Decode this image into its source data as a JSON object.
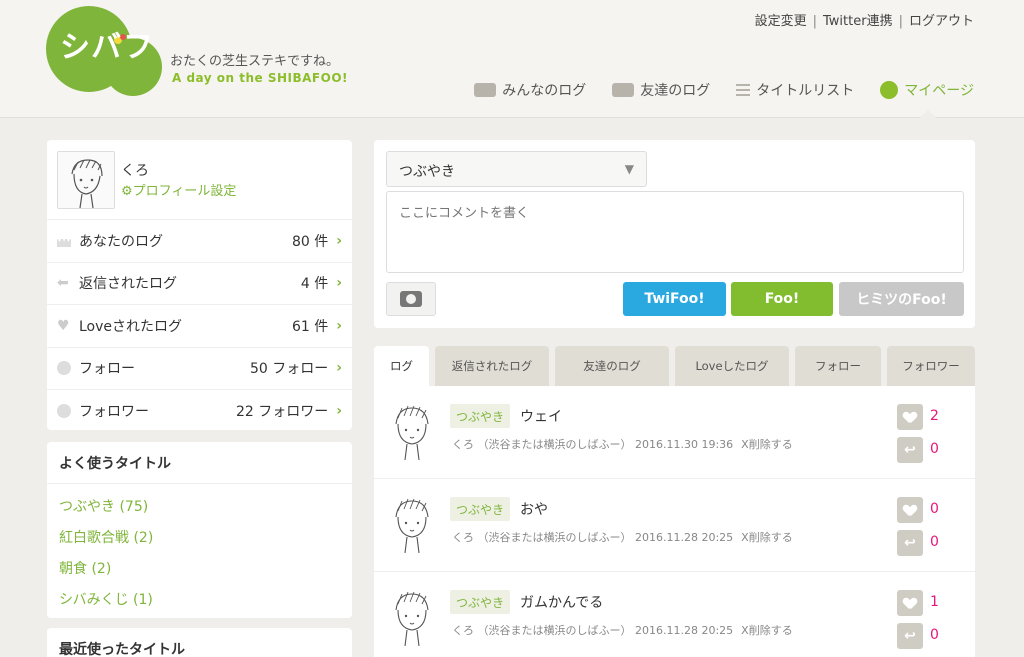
{
  "header": {
    "logo_text": "シバフ",
    "tagline": "おたくの芝生ステキですね。",
    "tagline_en": "A day on the SHIBAFOO!",
    "top_links": [
      "設定変更",
      "Twitter連携",
      "ログアウト"
    ],
    "separator": "|",
    "nav": [
      {
        "label": "みんなのログ",
        "icon": "chat-bubbles-icon"
      },
      {
        "label": "友達のログ",
        "icon": "chat-bubbles-icon"
      },
      {
        "label": "タイトルリスト",
        "icon": "list-icon"
      },
      {
        "label": "マイページ",
        "icon": "face-icon"
      }
    ]
  },
  "profile": {
    "name": "くろ",
    "settings_link": "プロフィール設定",
    "stats": [
      {
        "label": "あなたのログ",
        "value": "80 件",
        "icon": "grass-icon"
      },
      {
        "label": "返信されたログ",
        "value": "4 件",
        "icon": "reply-icon"
      },
      {
        "label": "Loveされたログ",
        "value": "61 件",
        "icon": "heart-icon"
      },
      {
        "label": "フォロー",
        "value": "50 フォロー",
        "icon": "face-icon"
      },
      {
        "label": "フォロワー",
        "value": "22 フォロワー",
        "icon": "face-icon"
      }
    ]
  },
  "favorite_titles": {
    "heading": "よく使うタイトル",
    "items": [
      "つぶやき (75)",
      "紅白歌合戦 (2)",
      "朝食 (2)",
      "シバみくじ (1)"
    ]
  },
  "recent_titles": {
    "heading": "最近使ったタイトル"
  },
  "composer": {
    "selected_title": "つぶやき",
    "placeholder": "ここにコメントを書く",
    "buttons": {
      "twifoo": "TwiFoo!",
      "foo": "Foo!",
      "himitsu": "ヒミツのFoo!"
    }
  },
  "tabs": [
    "ログ",
    "返信されたログ",
    "友達のログ",
    "Loveしたログ",
    "フォロー",
    "フォロワー"
  ],
  "posts": [
    {
      "tag": "つぶやき",
      "text": "ウェイ",
      "meta": "くろ （渋谷または横浜のしばふー） 2016.11.30 19:36",
      "delete": "X削除する",
      "likes": "2",
      "replies": "0"
    },
    {
      "tag": "つぶやき",
      "text": "おや",
      "meta": "くろ （渋谷または横浜のしばふー） 2016.11.28 20:25",
      "delete": "X削除する",
      "likes": "0",
      "replies": "0"
    },
    {
      "tag": "つぶやき",
      "text": "ガムかんでる",
      "meta": "くろ （渋谷または横浜のしばふー） 2016.11.28 20:25",
      "delete": "X削除する",
      "likes": "1",
      "replies": "0"
    }
  ],
  "colors": {
    "accent": "#7fb53a",
    "twifoo": "#2aa8e0",
    "foo": "#82bd30",
    "count": "#e8157a"
  }
}
